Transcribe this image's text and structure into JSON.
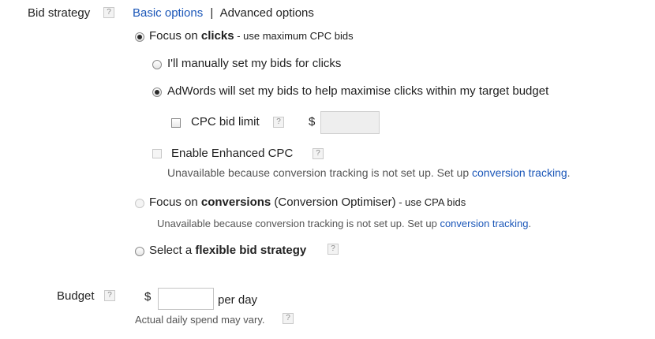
{
  "bid_strategy": {
    "label": "Bid strategy",
    "help": "?",
    "tabs": {
      "basic": "Basic options",
      "separator": "|",
      "advanced": "Advanced options"
    },
    "focus_clicks": {
      "prefix": "Focus on ",
      "bold": "clicks",
      "suffix": " - use maximum CPC bids",
      "selected": true
    },
    "manual_bids": {
      "label": "I'll manually set my bids for clicks",
      "selected": false
    },
    "auto_bids": {
      "label": "AdWords will set my bids to help maximise clicks within my target budget",
      "selected": true
    },
    "cpc_limit": {
      "label": "CPC bid limit",
      "help": "?",
      "currency": "$",
      "value": "",
      "checked": false
    },
    "enhanced_cpc": {
      "label": "Enable Enhanced CPC",
      "help": "?",
      "checked": false,
      "note_prefix": "Unavailable because conversion tracking is not set up. Set up ",
      "note_link": "conversion tracking",
      "note_suffix": "."
    },
    "focus_conversions": {
      "prefix": "Focus on ",
      "bold": "conversions",
      "middle": " (Conversion Optimiser)",
      "suffix": " - use CPA bids",
      "selected": false,
      "note_prefix": "Unavailable because conversion tracking is not set up. Set up ",
      "note_link": "conversion tracking",
      "note_suffix": "."
    },
    "flexible": {
      "prefix": "Select a ",
      "bold": "flexible bid strategy",
      "help": "?",
      "selected": false
    }
  },
  "budget": {
    "label": "Budget",
    "help": "?",
    "currency": "$",
    "value": "",
    "unit": "per day",
    "note": "Actual daily spend may vary.",
    "note_help": "?"
  },
  "colors": {
    "link": "#1a56b8",
    "text": "#222222",
    "muted": "#555555"
  }
}
